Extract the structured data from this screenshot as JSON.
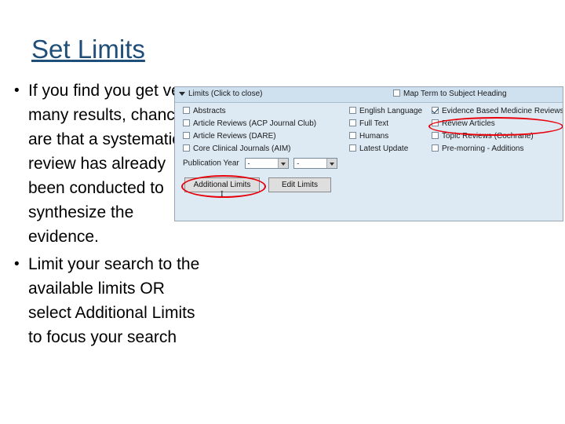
{
  "slide": {
    "title": "Set Limits",
    "bullets": [
      "If you find you get very many results, chances are that a systematic review has already been conducted to synthesize the evidence.",
      "Limit your search to the available limits OR select Additional Limits to focus your search"
    ],
    "bullet_marker": "•"
  },
  "screenshot": {
    "header": {
      "limits_label": "Limits  (Click to close)",
      "map_term_label": "Map Term to Subject Heading",
      "map_term_checked": false,
      "expander_icon": "triangle-down-icon"
    },
    "limit_columns": [
      {
        "name": "column-1",
        "options": [
          {
            "label": "Abstracts",
            "checked": false
          },
          {
            "label": "Article Reviews (ACP Journal Club)",
            "checked": false
          },
          {
            "label": "Article Reviews (DARE)",
            "checked": false
          },
          {
            "label": "Core Clinical Journals (AIM)",
            "checked": false
          }
        ]
      },
      {
        "name": "column-2",
        "options": [
          {
            "label": "English Language",
            "checked": false
          },
          {
            "label": "Full Text",
            "checked": false
          },
          {
            "label": "Humans",
            "checked": false
          },
          {
            "label": "Latest Update",
            "checked": false
          }
        ]
      },
      {
        "name": "column-3",
        "options": [
          {
            "label": "Evidence Based Medicine Reviews",
            "checked": true
          },
          {
            "label": "Review Articles",
            "checked": false
          },
          {
            "label": "Topic Reviews (Cochrane)",
            "checked": false
          },
          {
            "label": "Pre-morning - Additions",
            "checked": false
          }
        ]
      }
    ],
    "publication_year": {
      "label": "Publication Year",
      "from_value": "-",
      "to_value": "-",
      "dropdown_icon": "chevron-down-icon"
    },
    "buttons": {
      "additional_limits": "Additional Limits",
      "edit_limits": "Edit Limits"
    },
    "annotations": [
      {
        "name": "highlight-evidence-based-medicine-reviews",
        "shape": "ellipse",
        "color": "#E8000B"
      },
      {
        "name": "highlight-additional-limits",
        "shape": "ellipse",
        "color": "#E8000B"
      }
    ],
    "cursor_glyph": "I"
  },
  "colors": {
    "title": "#1F4E79",
    "panel_header": "#CFE0EF",
    "panel_body": "#DDEAF4",
    "annotation": "#E8000B"
  }
}
